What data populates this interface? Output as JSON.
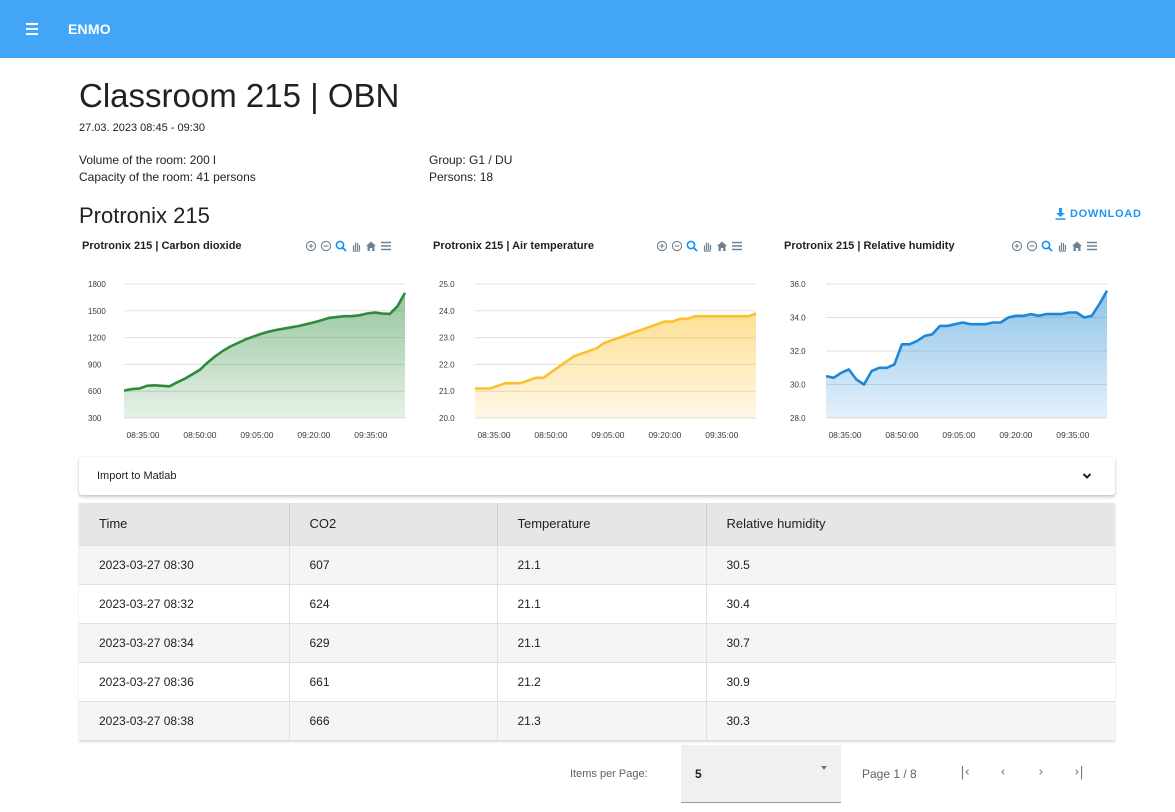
{
  "appbar": {
    "title": "ENMO"
  },
  "header": {
    "title": "Classroom 215 | OBN",
    "date": "27.03. 2023 08:45 - 09:30",
    "volume": "Volume of the room: 200 l",
    "capacity": "Capacity of the room: 41 persons",
    "group": "Group: G1 / DU",
    "persons": "Persons: 18"
  },
  "device": {
    "title": "Protronix 215",
    "download_label": "DOWNLOAD"
  },
  "colors": {
    "appbar": "#42a5f5",
    "co2": "#2e8b3b",
    "temperature": "#fbc02d",
    "humidity": "#1e88d6",
    "accent": "#2196f3"
  },
  "chart_data": [
    {
      "type": "area",
      "title": "Protronix 215 | Carbon dioxide",
      "x": [
        "08:30",
        "08:32",
        "08:34",
        "08:36",
        "08:38",
        "08:40",
        "08:42",
        "08:44",
        "08:46",
        "08:48",
        "08:50",
        "08:52",
        "08:54",
        "08:56",
        "08:58",
        "09:00",
        "09:02",
        "09:04",
        "09:06",
        "09:08",
        "09:10",
        "09:12",
        "09:14",
        "09:16",
        "09:18",
        "09:20",
        "09:22",
        "09:24",
        "09:26",
        "09:28",
        "09:30",
        "09:32",
        "09:34",
        "09:36",
        "09:38",
        "09:40",
        "09:42",
        "09:44"
      ],
      "xticks": [
        "08:35:00",
        "08:50:00",
        "09:05:00",
        "09:20:00",
        "09:35:00"
      ],
      "yticks": [
        "300",
        "600",
        "900",
        "1200",
        "1500",
        "1800"
      ],
      "ylim": [
        300,
        1800
      ],
      "series": [
        {
          "values": [
            607,
            624,
            629,
            661,
            666,
            660,
            655,
            700,
            740,
            790,
            840,
            920,
            990,
            1050,
            1100,
            1140,
            1180,
            1210,
            1240,
            1265,
            1285,
            1300,
            1315,
            1330,
            1350,
            1370,
            1395,
            1420,
            1430,
            1440,
            1440,
            1450,
            1470,
            1480,
            1470,
            1465,
            1550,
            1700
          ]
        }
      ]
    },
    {
      "type": "area",
      "title": "Protronix 215 | Air temperature",
      "x": [
        "08:30",
        "08:32",
        "08:34",
        "08:36",
        "08:38",
        "08:40",
        "08:42",
        "08:44",
        "08:46",
        "08:48",
        "08:50",
        "08:52",
        "08:54",
        "08:56",
        "08:58",
        "09:00",
        "09:02",
        "09:04",
        "09:06",
        "09:08",
        "09:10",
        "09:12",
        "09:14",
        "09:16",
        "09:18",
        "09:20",
        "09:22",
        "09:24",
        "09:26",
        "09:28",
        "09:30",
        "09:32",
        "09:34",
        "09:36",
        "09:38",
        "09:40",
        "09:42",
        "09:44"
      ],
      "xticks": [
        "08:35:00",
        "08:50:00",
        "09:05:00",
        "09:20:00",
        "09:35:00"
      ],
      "yticks": [
        "20.0",
        "21.0",
        "22.0",
        "23.0",
        "24.0",
        "25.0"
      ],
      "ylim": [
        20,
        25
      ],
      "series": [
        {
          "values": [
            21.1,
            21.1,
            21.1,
            21.2,
            21.3,
            21.3,
            21.3,
            21.4,
            21.5,
            21.5,
            21.7,
            21.9,
            22.1,
            22.3,
            22.4,
            22.5,
            22.6,
            22.8,
            22.9,
            23.0,
            23.1,
            23.2,
            23.3,
            23.4,
            23.5,
            23.6,
            23.6,
            23.7,
            23.7,
            23.8,
            23.8,
            23.8,
            23.8,
            23.8,
            23.8,
            23.8,
            23.8,
            23.9
          ]
        }
      ]
    },
    {
      "type": "area",
      "title": "Protronix 215 | Relative humidity",
      "x": [
        "08:30",
        "08:32",
        "08:34",
        "08:36",
        "08:38",
        "08:40",
        "08:42",
        "08:44",
        "08:46",
        "08:48",
        "08:50",
        "08:52",
        "08:54",
        "08:56",
        "08:58",
        "09:00",
        "09:02",
        "09:04",
        "09:06",
        "09:08",
        "09:10",
        "09:12",
        "09:14",
        "09:16",
        "09:18",
        "09:20",
        "09:22",
        "09:24",
        "09:26",
        "09:28",
        "09:30",
        "09:32",
        "09:34",
        "09:36",
        "09:38",
        "09:40",
        "09:42",
        "09:44"
      ],
      "xticks": [
        "08:35:00",
        "08:50:00",
        "09:05:00",
        "09:20:00",
        "09:35:00"
      ],
      "yticks": [
        "28.0",
        "30.0",
        "32.0",
        "34.0",
        "36.0"
      ],
      "ylim": [
        28,
        36
      ],
      "series": [
        {
          "values": [
            30.5,
            30.4,
            30.7,
            30.9,
            30.3,
            30.0,
            30.8,
            31.0,
            31.0,
            31.2,
            32.4,
            32.4,
            32.6,
            32.9,
            33.0,
            33.5,
            33.5,
            33.6,
            33.7,
            33.6,
            33.6,
            33.6,
            33.7,
            33.7,
            34.0,
            34.1,
            34.1,
            34.2,
            34.1,
            34.2,
            34.2,
            34.2,
            34.3,
            34.3,
            34.0,
            34.1,
            34.8,
            35.6
          ]
        }
      ]
    }
  ],
  "chart_tools": [
    "zoom-in-icon",
    "zoom-out-icon",
    "zoom-select-icon",
    "pan-icon",
    "home-icon",
    "menu-icon"
  ],
  "expansion": {
    "label": "Import to Matlab"
  },
  "table": {
    "headers": [
      "Time",
      "CO2",
      "Temperature",
      "Relative humidity"
    ],
    "rows": [
      [
        "2023-03-27 08:30",
        "607",
        "21.1",
        "30.5"
      ],
      [
        "2023-03-27 08:32",
        "624",
        "21.1",
        "30.4"
      ],
      [
        "2023-03-27 08:34",
        "629",
        "21.1",
        "30.7"
      ],
      [
        "2023-03-27 08:36",
        "661",
        "21.2",
        "30.9"
      ],
      [
        "2023-03-27 08:38",
        "666",
        "21.3",
        "30.3"
      ]
    ]
  },
  "pager": {
    "items_per_page_label": "Items per Page:",
    "items_per_page_value": "5",
    "page_text": "Page 1 / 8",
    "first": "|‹",
    "prev": "‹",
    "next": "›",
    "last": "›|"
  }
}
